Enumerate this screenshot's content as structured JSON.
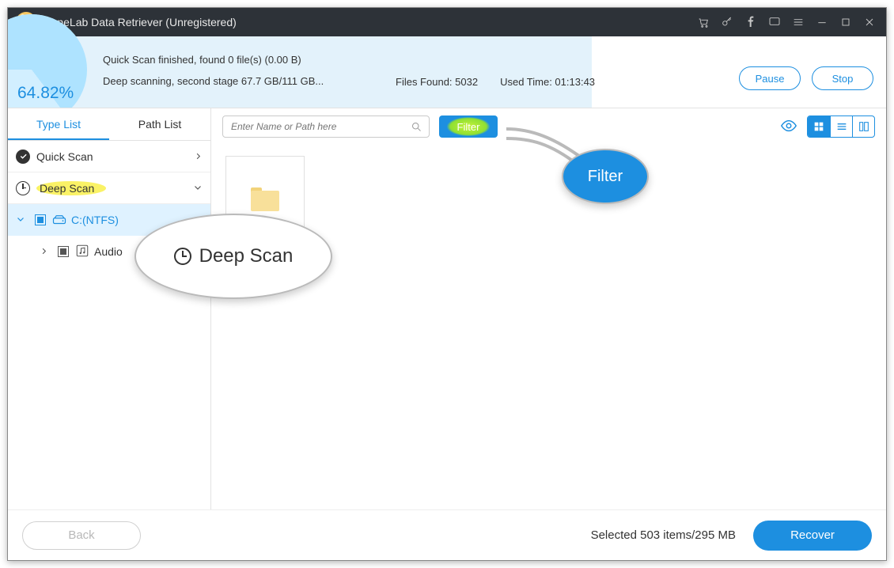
{
  "titlebar": {
    "title": "FoneLab Data Retriever (Unregistered)"
  },
  "status": {
    "percent": "64.82%",
    "line1": "Quick Scan finished, found 0 file(s) (0.00  B)",
    "line2": "Deep scanning, second stage 67.7 GB/111 GB...",
    "files_found_label": "Files Found: 5032",
    "used_time_label": "Used Time: 01:13:43",
    "pause": "Pause",
    "stop": "Stop"
  },
  "sidebar": {
    "tabs": {
      "type_list": "Type List",
      "path_list": "Path List"
    },
    "items": {
      "quick_scan": "Quick Scan",
      "deep_scan": "Deep Scan",
      "drive": "C:(NTFS)",
      "audio": "Audio"
    }
  },
  "toolbar": {
    "search_placeholder": "Enter Name or Path here",
    "filter": "Filter"
  },
  "footer": {
    "back": "Back",
    "selected": "Selected 503 items/295 MB",
    "recover": "Recover"
  },
  "callouts": {
    "deep_scan": "Deep Scan",
    "filter": "Filter"
  }
}
